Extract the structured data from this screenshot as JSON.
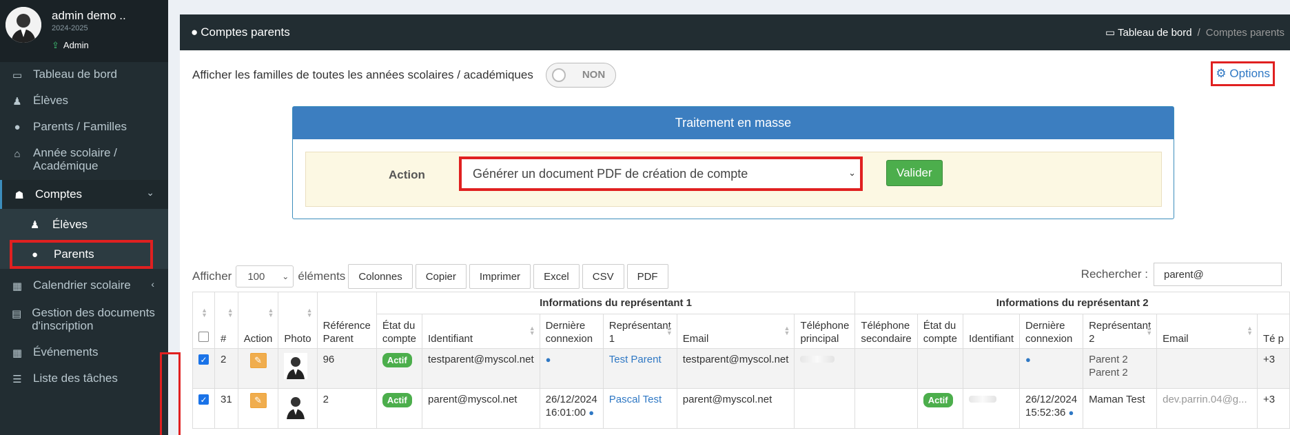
{
  "user": {
    "name": "admin demo ..",
    "year": "2024-2025",
    "role": "Admin"
  },
  "sidebar": {
    "items": [
      {
        "label": "Tableau de bord",
        "icon": "laptop-icon"
      },
      {
        "label": "Élèves",
        "icon": "student-icon"
      },
      {
        "label": "Parents / Familles",
        "icon": "user-icon"
      },
      {
        "label": "Année scolaire / Académique",
        "icon": "home-icon"
      },
      {
        "label": "Comptes",
        "icon": "users-icon"
      },
      {
        "label": "Calendrier scolaire",
        "icon": "calendar-icon"
      },
      {
        "label": "Gestion des documents d'inscription",
        "icon": "file-icon"
      },
      {
        "label": "Événements",
        "icon": "calendar-icon"
      },
      {
        "label": "Liste des tâches",
        "icon": "list-icon"
      }
    ],
    "sub": [
      {
        "label": "Élèves"
      },
      {
        "label": "Parents"
      }
    ]
  },
  "header": {
    "title": "Comptes parents",
    "bc_home": "Tableau de bord",
    "bc_sep": "/",
    "bc_current": "Comptes parents"
  },
  "toggle": {
    "label": "Afficher les familles de toutes les années scolaires / académiques",
    "state": "NON"
  },
  "options_label": "Options",
  "mass": {
    "title": "Traitement en masse",
    "action_label": "Action",
    "selected": "Générer un document PDF de création de compte",
    "submit": "Valider"
  },
  "datatable": {
    "show_label": "Afficher",
    "length": "100",
    "elements_label": "éléments",
    "buttons": [
      "Colonnes",
      "Copier",
      "Imprimer",
      "Excel",
      "CSV",
      "PDF"
    ],
    "search_label": "Rechercher :",
    "search_value": "parent@"
  },
  "table": {
    "group1": "Informations du représentant 1",
    "group2": "Informations du représentant 2",
    "cols": {
      "num": "#",
      "action": "Action",
      "photo": "Photo",
      "ref": "Référence Parent",
      "state": "État du compte",
      "ident": "Identifiant",
      "last": "Dernière connexion",
      "rep1": "Représentant 1",
      "email": "Email",
      "tel1": "Téléphone principal",
      "tel2": "Téléphone secondaire",
      "state2": "État du compte",
      "ident2": "Identifiant",
      "last2": "Dernière connexion",
      "rep2": "Représentant 2",
      "email2": "Email",
      "tel3": "Té p"
    },
    "rows": [
      {
        "num": "2",
        "ref": "96",
        "state": "Actif",
        "ident": "testparent@myscol.net",
        "last": "",
        "rep1": "Test Parent",
        "email": "testparent@myscol.net",
        "state2": "",
        "last2": "",
        "rep2a": "Parent 2",
        "rep2b": "Parent 2",
        "tel3": "+3"
      },
      {
        "num": "31",
        "ref": "2",
        "state": "Actif",
        "ident": "parent@myscol.net",
        "last_date": "26/12/2024",
        "last_time": "16:01:00",
        "rep1": "Pascal Test",
        "email": "parent@myscol.net",
        "state2": "Actif",
        "last2_date": "26/12/2024",
        "last2_time": "15:52:36",
        "rep2a": "Maman Test",
        "email2": "dev.parrin.04@g...",
        "tel3": "+3"
      }
    ]
  },
  "colors": {
    "sidebar": "#222d32",
    "accent": "#3c8dbc",
    "success": "#4cae4c",
    "warning": "#f0ad4e",
    "highlight": "#e02020"
  }
}
